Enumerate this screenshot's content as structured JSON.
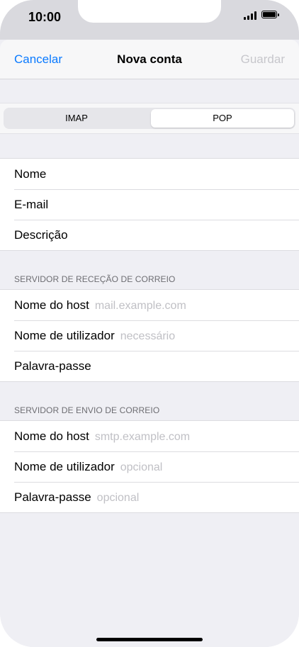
{
  "status_bar": {
    "time": "10:00"
  },
  "nav": {
    "cancel": "Cancelar",
    "title": "Nova conta",
    "save": "Guardar"
  },
  "segment": {
    "options": [
      "IMAP",
      "POP"
    ],
    "selected": "POP"
  },
  "account": {
    "rows": [
      {
        "label": "Nome"
      },
      {
        "label": "E-mail"
      },
      {
        "label": "Descrição"
      }
    ]
  },
  "incoming": {
    "header": "SERVIDOR DE RECEÇÃO DE CORREIO",
    "rows": [
      {
        "label": "Nome do host",
        "placeholder": "mail.example.com"
      },
      {
        "label": "Nome de utilizador",
        "placeholder": "necessário"
      },
      {
        "label": "Palavra-passe",
        "placeholder": ""
      }
    ]
  },
  "outgoing": {
    "header": "SERVIDOR DE ENVIO DE CORREIO",
    "rows": [
      {
        "label": "Nome do host",
        "placeholder": "smtp.example.com"
      },
      {
        "label": "Nome de utilizador",
        "placeholder": "opcional"
      },
      {
        "label": "Palavra-passe",
        "placeholder": "opcional"
      }
    ]
  }
}
